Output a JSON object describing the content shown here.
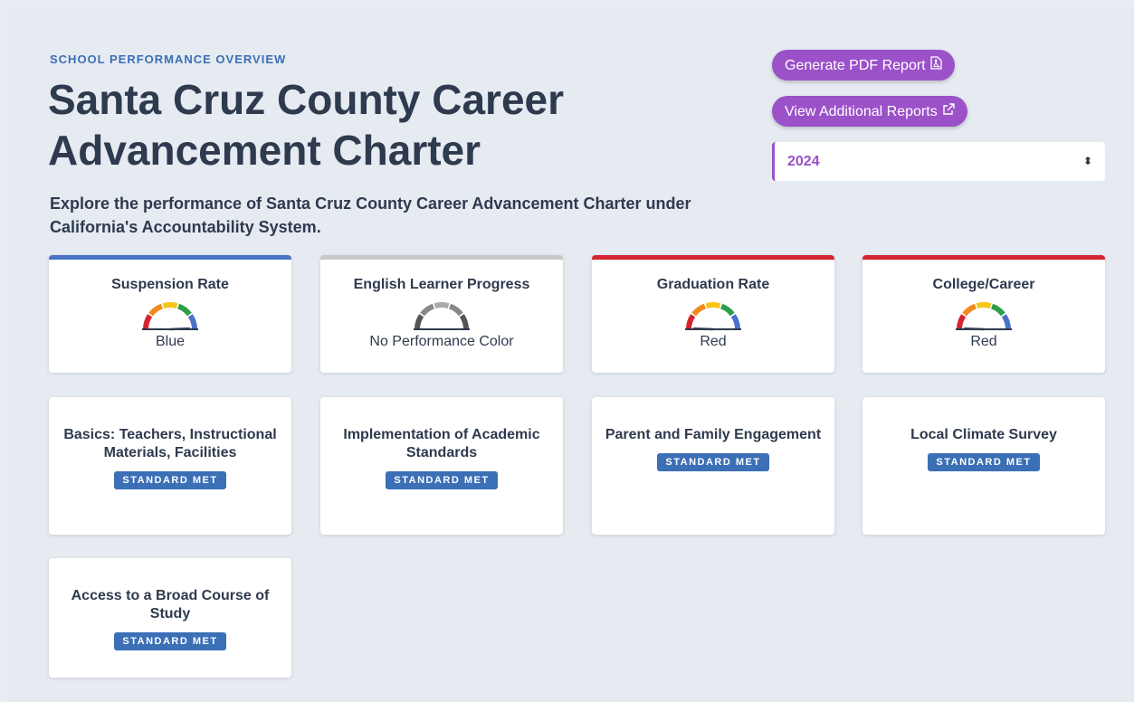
{
  "header": {
    "eyebrow": "SCHOOL PERFORMANCE OVERVIEW",
    "title": "Santa Cruz County Career Advancement Charter",
    "subtitle": "Explore the performance of Santa Cruz County Career Advancement Charter under California's Accountability System."
  },
  "actions": {
    "pdf_label": "Generate PDF Report",
    "reports_label": "View Additional Reports"
  },
  "year_select": {
    "selected": "2024"
  },
  "icons": {
    "pdf": "pdf-file-icon",
    "external": "external-link-icon",
    "select": "select-arrows-icon",
    "gauge": "gauge-icon"
  },
  "colors": {
    "accent": "#9b51c8",
    "blue": "#4a72c8",
    "red": "#d42431",
    "gray": "#c8c8c8",
    "badge": "#3b6fb6"
  },
  "indicators": [
    {
      "title": "Suspension Rate",
      "value": "Blue",
      "level": 5
    },
    {
      "title": "English Learner Progress",
      "value": "No Performance Color",
      "level": 0
    },
    {
      "title": "Graduation Rate",
      "value": "Red",
      "level": 1
    },
    {
      "title": "College/Career",
      "value": "Red",
      "level": 1
    }
  ],
  "local_indicators": [
    {
      "title": "Basics: Teachers, Instructional Materials, Facilities",
      "status": "STANDARD MET"
    },
    {
      "title": "Implementation of Academic Standards",
      "status": "STANDARD MET"
    },
    {
      "title": "Parent and Family Engagement",
      "status": "STANDARD MET"
    },
    {
      "title": "Local Climate Survey",
      "status": "STANDARD MET"
    },
    {
      "title": "Access to a Broad Course of Study",
      "status": "STANDARD MET"
    }
  ]
}
